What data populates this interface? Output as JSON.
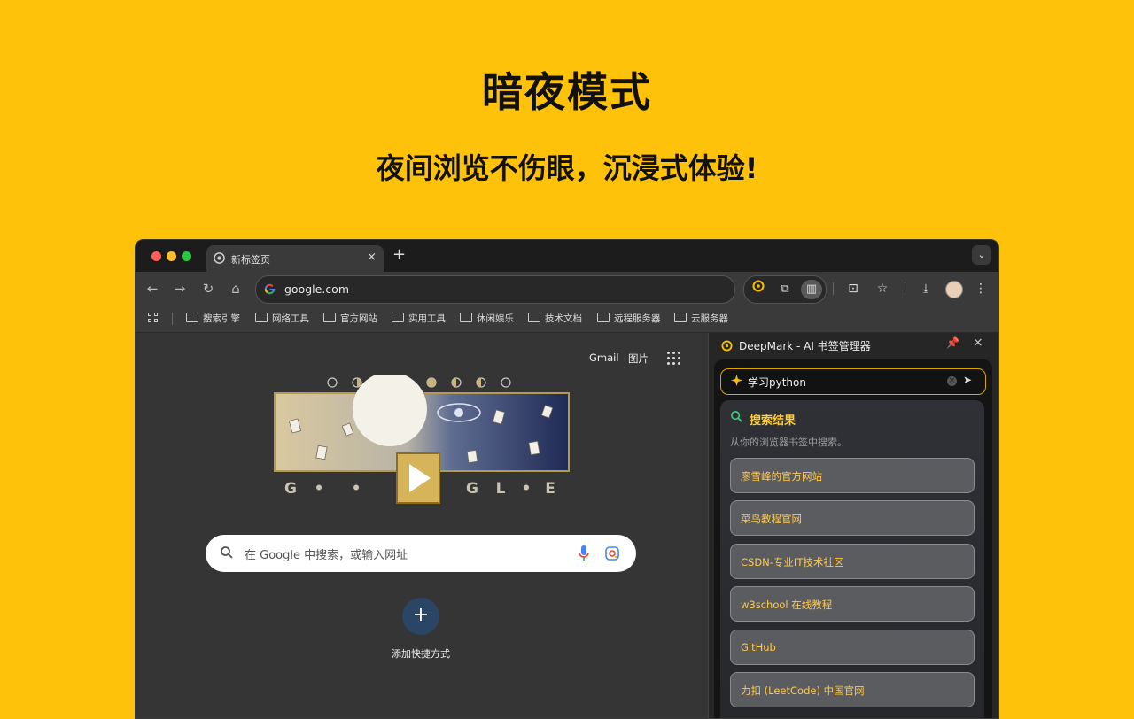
{
  "hero": {
    "title": "暗夜模式",
    "subtitle": "夜间浏览不伤眼，沉浸式体验!"
  },
  "browser": {
    "tab": {
      "title": "新标签页",
      "close": "×"
    },
    "new_tab": "+",
    "address": "google.com",
    "bookmarks": [
      "搜索引擎",
      "网络工具",
      "官方网站",
      "实用工具",
      "休闲娱乐",
      "技术文档",
      "远程服务器",
      "云服务器"
    ]
  },
  "newtab_page": {
    "gmail": "Gmail",
    "images": "图片",
    "doodle_letters": [
      "G",
      "•",
      "•",
      "G",
      "L",
      "•",
      "E"
    ],
    "search_placeholder": "在 Google 中搜索，或输入网址",
    "add_shortcut_icon": "+",
    "add_shortcut": "添加快捷方式"
  },
  "side_panel": {
    "title": "DeepMark - AI 书签管理器",
    "query": "学习python",
    "results_title": "搜索结果",
    "results_subtitle": "从你的浏览器书签中搜索。",
    "results": [
      "廖雪峰的官方网站",
      "菜鸟教程官网",
      "CSDN-专业IT技术社区",
      "w3school 在线教程",
      "GitHub",
      "力扣 (LeetCode) 中国官网"
    ]
  },
  "colors": {
    "background": "#FFC20A",
    "accent": "#ffc94a",
    "dark_panel": "#141414"
  }
}
